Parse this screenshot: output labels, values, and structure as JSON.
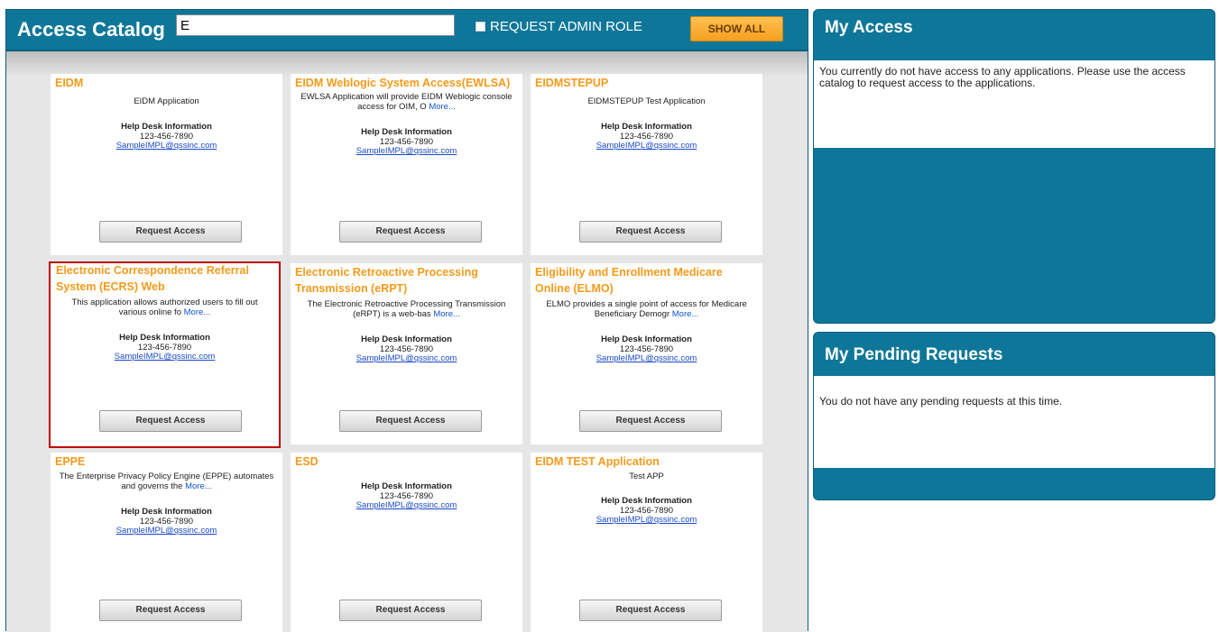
{
  "catalog": {
    "title": "Access Catalog",
    "search_value": "E",
    "admin_role_label": "REQUEST ADMIN ROLE",
    "show_all_label": "SHOW ALL"
  },
  "cards": [
    {
      "title": "EIDM",
      "desc": "EIDM Application",
      "more": "",
      "help_title": "Help Desk Information",
      "phone": "123-456-7890",
      "email": "SampleIMPL@qssinc.com",
      "button": "Request Access"
    },
    {
      "title": "EIDM Weblogic System Access(EWLSA)",
      "desc": "EWLSA Application will provide EIDM Weblogic console access for OIM, O",
      "more": "More...",
      "help_title": "Help Desk Information",
      "phone": "123-456-7890",
      "email": "SampleIMPL@qssinc.com",
      "button": "Request Access"
    },
    {
      "title": "EIDMSTEPUP",
      "desc": "EIDMSTEPUP Test Application",
      "more": "",
      "help_title": "Help Desk Information",
      "phone": "123-456-7890",
      "email": "SampleIMPL@qssinc.com",
      "button": "Request Access"
    },
    {
      "title": "Electronic Correspondence Referral System (ECRS) Web",
      "desc": "This application allows authorized users to fill out various online fo",
      "more": "More...",
      "help_title": "Help Desk Information",
      "phone": "123-456-7890",
      "email": "SampleIMPL@qssinc.com",
      "button": "Request Access"
    },
    {
      "title": "Electronic Retroactive Processing Transmission (eRPT)",
      "desc": "The Electronic Retroactive Processing Transmission (eRPT) is a web-bas",
      "more": "More...",
      "help_title": "Help Desk Information",
      "phone": "123-456-7890",
      "email": "SampleIMPL@qssinc.com",
      "button": "Request Access"
    },
    {
      "title": "Eligibility and Enrollment Medicare Online (ELMO)",
      "desc": "ELMO provides a single point of access for Medicare Beneficiary Demogr",
      "more": "More...",
      "help_title": "Help Desk Information",
      "phone": "123-456-7890",
      "email": "SampleIMPL@qssinc.com",
      "button": "Request Access"
    },
    {
      "title": "EPPE",
      "desc": "The Enterprise Privacy Policy Engine (EPPE) automates and governs the",
      "more": "More...",
      "help_title": "Help Desk Information",
      "phone": "123-456-7890",
      "email": "SampleIMPL@qssinc.com",
      "button": "Request Access"
    },
    {
      "title": "ESD",
      "desc": "",
      "more": "",
      "help_title": "Help Desk Information",
      "phone": "123-456-7890",
      "email": "SampleIMPL@qssinc.com",
      "button": "Request Access"
    },
    {
      "title": "EIDM TEST Application",
      "desc": "Test APP",
      "more": "",
      "help_title": "Help Desk Information",
      "phone": "123-456-7890",
      "email": "SampleIMPL@qssinc.com",
      "button": "Request Access"
    }
  ],
  "my_access": {
    "title": "My Access",
    "message": "You currently do not have access to any applications. Please use the access catalog to request access to the applications."
  },
  "pending": {
    "title": "My Pending Requests",
    "message": "You do not have any pending requests at this time."
  }
}
